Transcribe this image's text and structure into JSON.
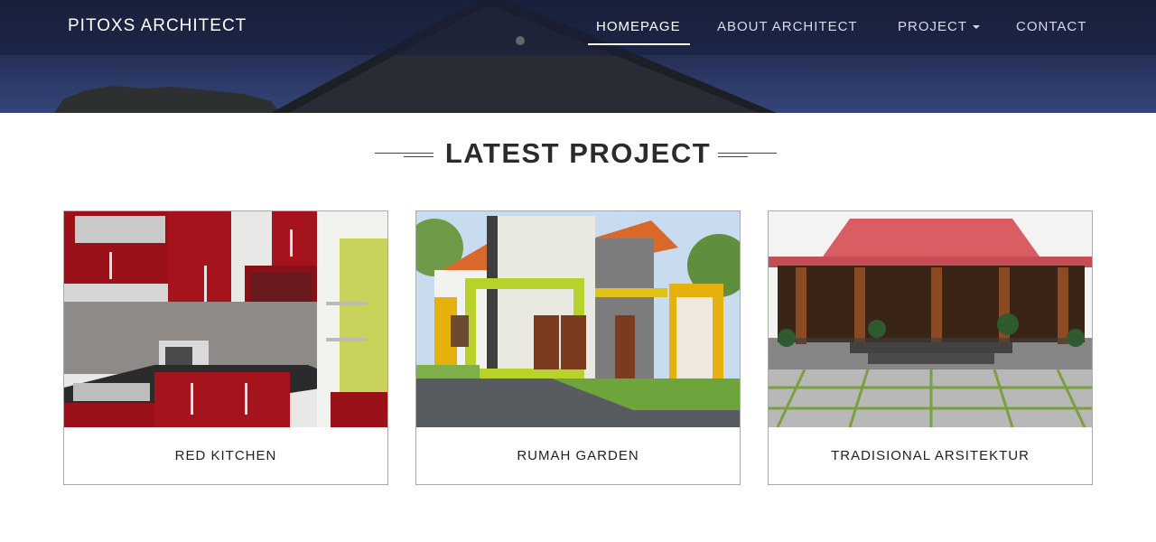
{
  "brand": "PITOXS ARCHITECT",
  "nav": {
    "items": [
      {
        "label": "HOMEPAGE",
        "active": true
      },
      {
        "label": "ABOUT ARCHITECT",
        "active": false
      },
      {
        "label": "PROJECT",
        "active": false,
        "dropdown": true
      },
      {
        "label": "CONTACT",
        "active": false
      }
    ]
  },
  "section": {
    "title": "LATEST PROJECT"
  },
  "projects": [
    {
      "caption": "RED KITCHEN"
    },
    {
      "caption": "RUMAH GARDEN"
    },
    {
      "caption": "TRADISIONAL ARSITEKTUR"
    }
  ],
  "colors": {
    "hero_dark": "#1c2440",
    "hero_light": "#34457a",
    "text_dark": "#2b2b2b",
    "card_border": "#aaaaaa"
  }
}
